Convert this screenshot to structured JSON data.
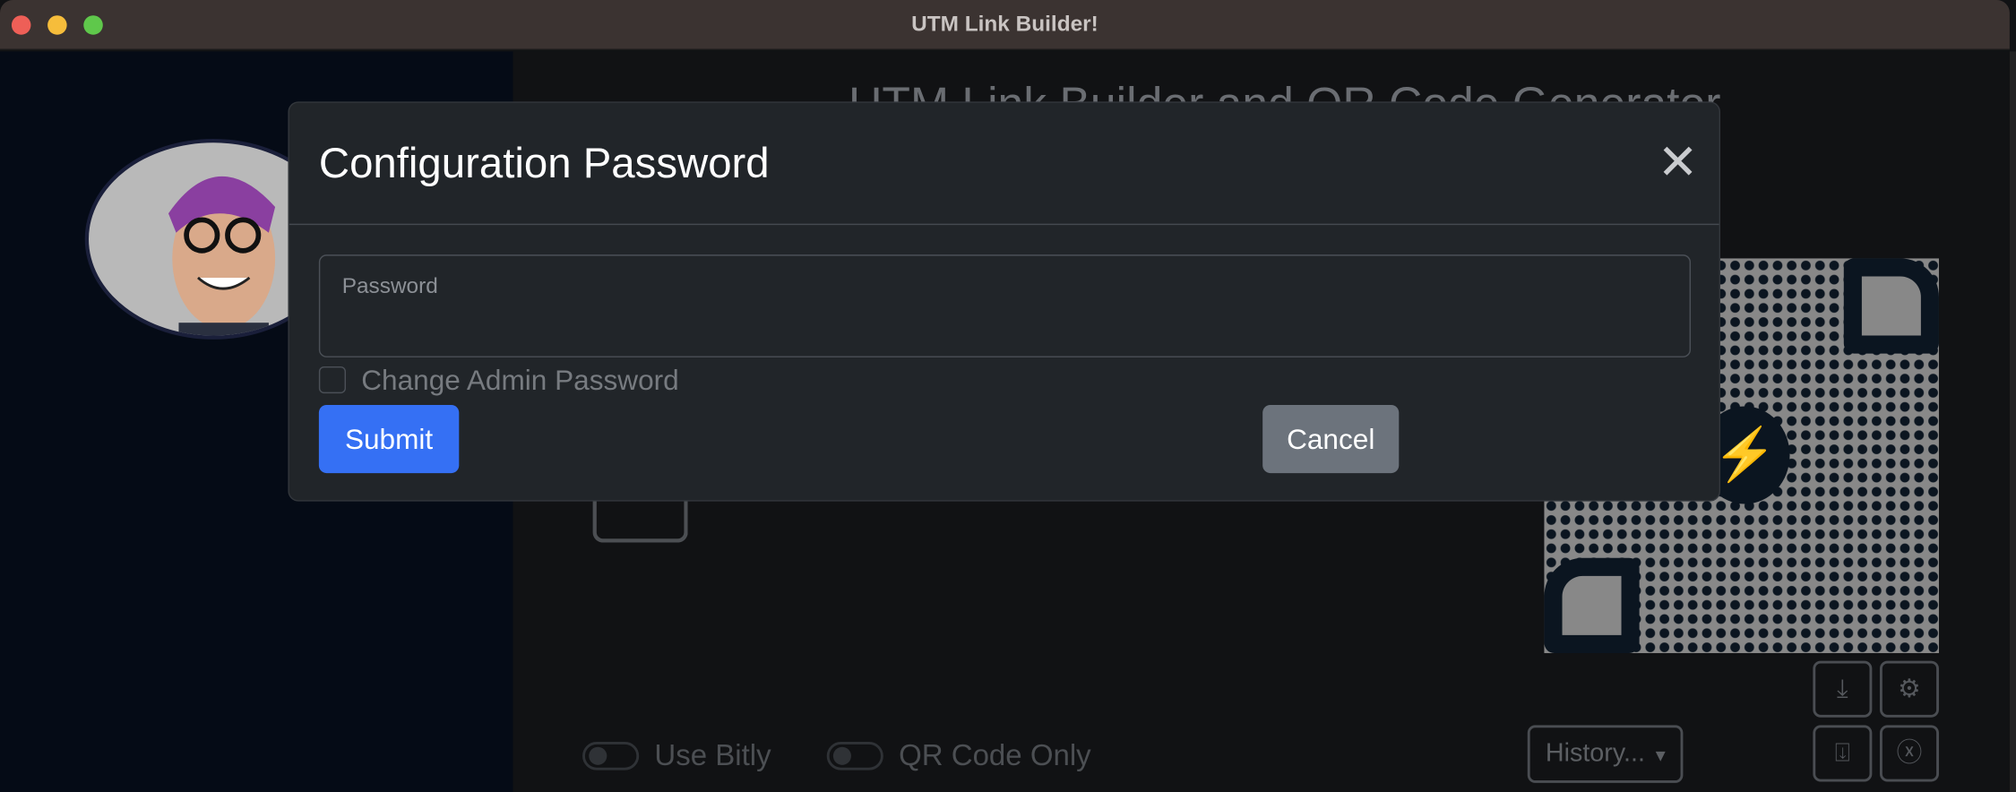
{
  "window": {
    "title": "UTM Link Builder!"
  },
  "background": {
    "page_title": "UTM Link Builder and QR Code Generator",
    "toggles": [
      {
        "label": "Use Bitly",
        "on": false
      },
      {
        "label": "QR Code Only",
        "on": false
      }
    ],
    "history_button": "History...",
    "icon_buttons": [
      "download-icon",
      "gear-icon",
      "save-download-icon",
      "close-circle-icon"
    ]
  },
  "modal": {
    "title": "Configuration Password",
    "password_label": "Password",
    "password_value": "",
    "checkbox_label": "Change Admin Password",
    "checkbox_checked": false,
    "submit_label": "Submit",
    "cancel_label": "Cancel"
  },
  "colors": {
    "primary": "#3570f4",
    "secondary": "#6c737c",
    "modal_bg": "#212529"
  }
}
